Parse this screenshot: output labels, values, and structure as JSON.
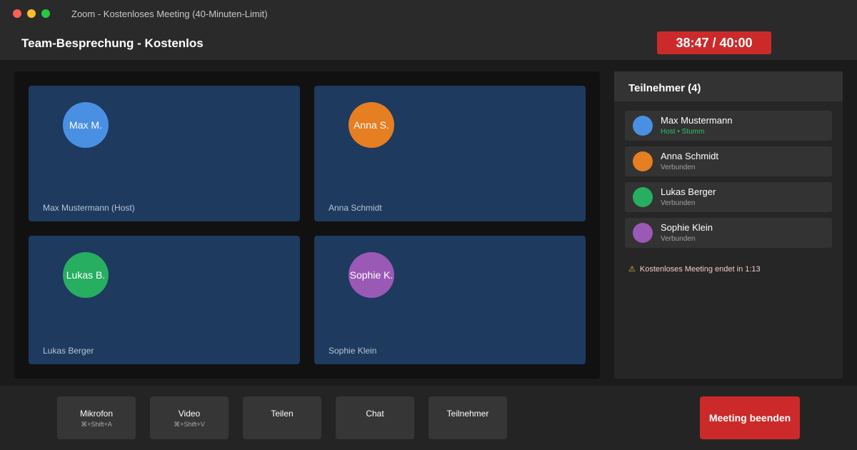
{
  "window": {
    "title": "Zoom - Kostenloses Meeting (40-Minuten-Limit)"
  },
  "header": {
    "meeting_title": "Team-Besprechung - Kostenlos",
    "timer_elapsed": "38:47",
    "timer_separator": " / ",
    "timer_limit": "40:00",
    "timer_color": "#cc2a2a"
  },
  "tiles": [
    {
      "initials": "Max M.",
      "name": "Max Mustermann (Host)",
      "avatar_color": "#4a90e2"
    },
    {
      "initials": "Anna S.",
      "name": "Anna Schmidt",
      "avatar_color": "#e67e22"
    },
    {
      "initials": "Lukas B.",
      "name": "Lukas Berger",
      "avatar_color": "#27ae60"
    },
    {
      "initials": "Sophie K.",
      "name": "Sophie Klein",
      "avatar_color": "#9b59b6"
    }
  ],
  "participants_panel": {
    "title": "Teilnehmer (4)",
    "items": [
      {
        "name": "Max Mustermann",
        "status": "Host • Stumm",
        "avatar_color": "#4a90e2"
      },
      {
        "name": "Anna Schmidt",
        "status": "Verbunden",
        "avatar_color": "#e67e22"
      },
      {
        "name": "Lukas Berger",
        "status": "Verbunden",
        "avatar_color": "#27ae60"
      },
      {
        "name": "Sophie Klein",
        "status": "Verbunden",
        "avatar_color": "#9b59b6"
      }
    ],
    "warning_icon": "warning-icon",
    "warning_symbol": "⚠",
    "warning_text": "Kostenloses Meeting endet in 1:13"
  },
  "toolbar": {
    "buttons": [
      {
        "label": "Mikrofon",
        "shortcut": "⌘+Shift+A"
      },
      {
        "label": "Video",
        "shortcut": "⌘+Shift+V"
      },
      {
        "label": "Teilen",
        "shortcut": ""
      },
      {
        "label": "Chat",
        "shortcut": ""
      },
      {
        "label": "Teilnehmer",
        "shortcut": ""
      }
    ],
    "end_label": "Meeting beenden",
    "end_color": "#cc2a2a"
  }
}
